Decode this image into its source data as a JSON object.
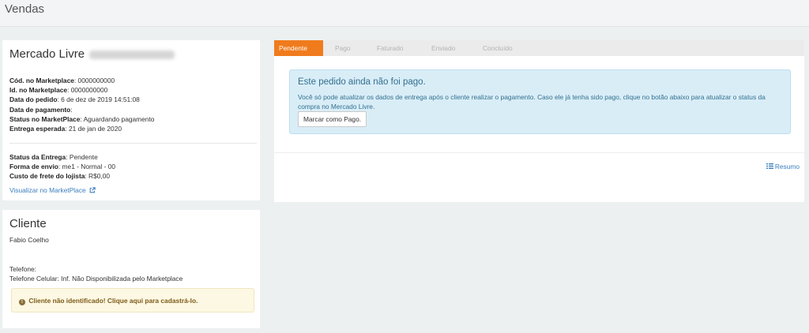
{
  "page": {
    "title": "Vendas"
  },
  "order": {
    "marketplace_name": "Mercado Livre",
    "fields": [
      {
        "label": "Cód. no Marketplace",
        "value": " 0000000000"
      },
      {
        "label": "Id. no Marketplace",
        "value": " 0000000000"
      },
      {
        "label": "Data do pedido",
        "value": " 6 de dez de 2019 14:51:08"
      },
      {
        "label": "Data de pagamento",
        "value": ""
      },
      {
        "label": "Status no MarketPlace",
        "value": " Aguardando pagamento"
      },
      {
        "label": "Entrega esperada",
        "value": " 21 de jan de 2020"
      }
    ],
    "shipping": [
      {
        "label": "Status da Entrega",
        "value": " Pendente"
      },
      {
        "label": "Forma de envio",
        "value": " me1 - Normal - 00"
      },
      {
        "label": "Custo de frete do lojista",
        "value": " R$0,00"
      }
    ],
    "view_link": "Visualizar no MarketPlace"
  },
  "client": {
    "title": "Cliente",
    "name": "Fabio Coelho",
    "phone": "Telefone:",
    "mobile": "Telefone Celular: Inf. Não Disponibilizada pelo Marketplace",
    "alert": "Cliente não identificado! Clique aqui para cadastrá-lo."
  },
  "status": {
    "steps": [
      "Pendente",
      "Pago",
      "Faturado",
      "Enviado",
      "Concluído"
    ],
    "active_step": "Pendente",
    "alert_title": "Este pedido ainda não foi pago.",
    "alert_text": "Você só pode atualizar os dados de entrega após o cliente realizar o pagamento. Caso ele já tenha sido pago, clique no botão abaixo para atualizar o status da compra no Mercado Livre.",
    "button_label": "Marcar como Pago.",
    "summary_link": "Resumo"
  },
  "colors": {
    "accent": "#f07b1d",
    "link": "#3a7ebf",
    "info_bg": "#d9edf7",
    "warning_bg": "#fcf8e3"
  },
  "icons": [
    "external-link-icon",
    "exclamation-circle-icon",
    "list-icon"
  ]
}
